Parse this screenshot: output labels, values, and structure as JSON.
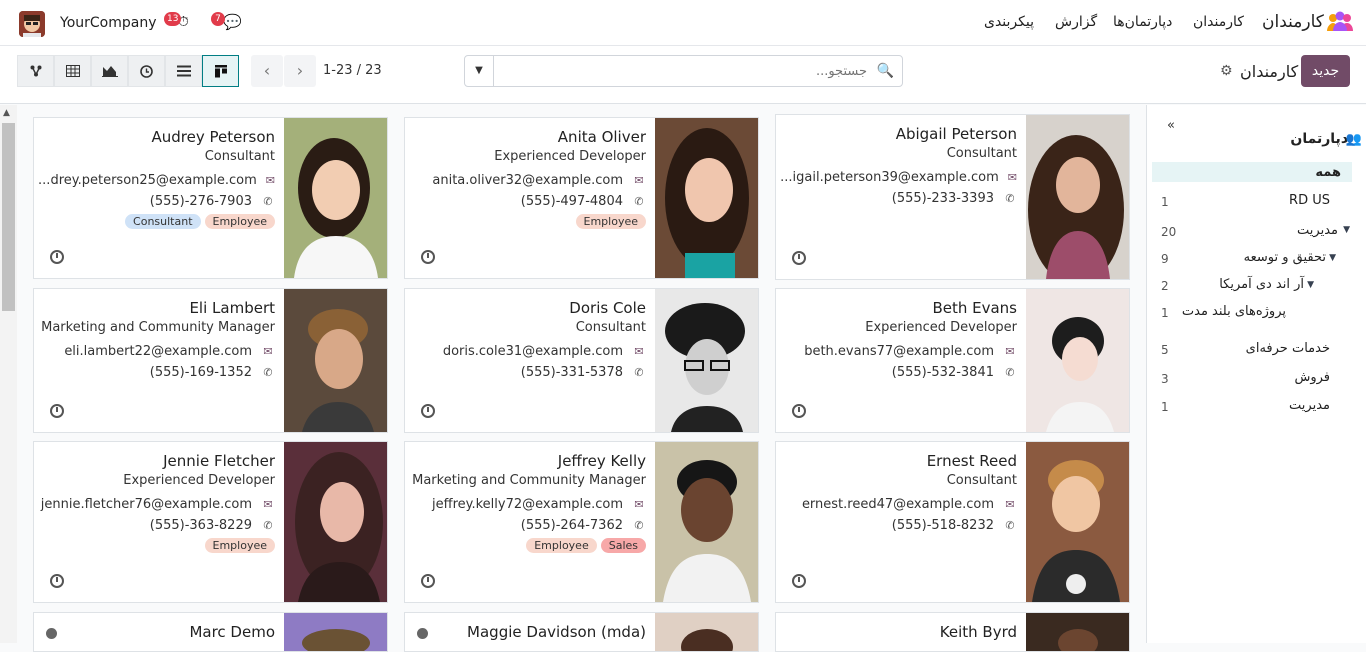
{
  "topbar": {
    "app_name": "کارمندان",
    "menu": [
      "کارمندان",
      "دپارتمان‌ها",
      "گزارش",
      "پیکربندی"
    ],
    "company": "YourCompany",
    "messages_count": "7",
    "activities_count": "13"
  },
  "control": {
    "new_label": "جدید",
    "breadcrumb": "کارمندان",
    "search_placeholder": "جستجو...",
    "pager": "1-23 / 23"
  },
  "sidepanel": {
    "title": "دپارتمان",
    "items": [
      {
        "label": "همه",
        "count": ""
      },
      {
        "label": "RD US",
        "count": "1"
      },
      {
        "label": "مدیریت",
        "count": "20"
      },
      {
        "label": "تحقیق و توسعه",
        "count": "9"
      },
      {
        "label": "آر اند دی آمریکا",
        "count": "2"
      },
      {
        "label": "پروژه‌های بلند مدت",
        "count": "1"
      },
      {
        "label": "خدمات حرفه‌ای",
        "count": "5"
      },
      {
        "label": "فروش",
        "count": "3"
      },
      {
        "label": "مدیریت",
        "count": "1"
      }
    ]
  },
  "employees": [
    {
      "name": "Abigail Peterson",
      "job": "Consultant",
      "email": "...igail.peterson39@example.com",
      "phone": "(555)-233-3393",
      "tags": []
    },
    {
      "name": "Anita Oliver",
      "job": "Experienced Developer",
      "email": "anita.oliver32@example.com",
      "phone": "(555)-497-4804",
      "tags": [
        "Employee"
      ]
    },
    {
      "name": "Audrey Peterson",
      "job": "Consultant",
      "email": "...drey.peterson25@example.com",
      "phone": "(555)-276-7903",
      "tags": [
        "Employee",
        "Consultant"
      ]
    },
    {
      "name": "Beth Evans",
      "job": "Experienced Developer",
      "email": "beth.evans77@example.com",
      "phone": "(555)-532-3841",
      "tags": []
    },
    {
      "name": "Doris Cole",
      "job": "Consultant",
      "email": "doris.cole31@example.com",
      "phone": "(555)-331-5378",
      "tags": []
    },
    {
      "name": "Eli Lambert",
      "job": "Marketing and Community Manager",
      "email": "eli.lambert22@example.com",
      "phone": "(555)-169-1352",
      "tags": []
    },
    {
      "name": "Ernest Reed",
      "job": "Consultant",
      "email": "ernest.reed47@example.com",
      "phone": "(555)-518-8232",
      "tags": []
    },
    {
      "name": "Jeffrey Kelly",
      "job": "Marketing and Community Manager",
      "email": "jeffrey.kelly72@example.com",
      "phone": "(555)-264-7362",
      "tags": [
        "Sales",
        "Employee"
      ]
    },
    {
      "name": "Jennie Fletcher",
      "job": "Experienced Developer",
      "email": "jennie.fletcher76@example.com",
      "phone": "(555)-363-8229",
      "tags": [
        "Employee"
      ]
    },
    {
      "name": "Keith Byrd",
      "job": "",
      "email": "",
      "phone": "",
      "tags": []
    },
    {
      "name": "Maggie Davidson (mda)",
      "job": "",
      "email": "",
      "phone": "",
      "tags": []
    },
    {
      "name": "Marc Demo",
      "job": "",
      "email": "",
      "phone": "",
      "tags": []
    }
  ],
  "colors": {
    "primary": "#714b67",
    "accent": "#017e84",
    "tag_employee": "#f8d7cc",
    "tag_consultant": "#cfe2f7",
    "tag_sales": "#f7a8a8"
  }
}
